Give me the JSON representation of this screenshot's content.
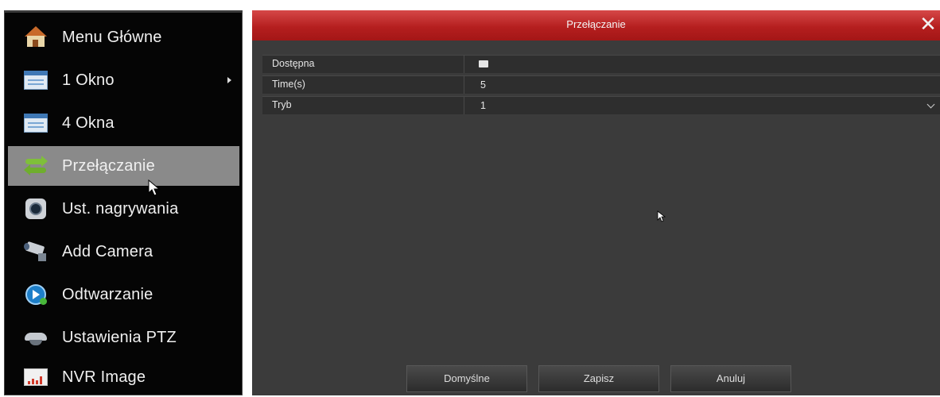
{
  "menu": {
    "items": [
      {
        "label": "Menu Główne",
        "icon": "home-icon"
      },
      {
        "label": "1 Okno",
        "icon": "single-window-icon",
        "has_submenu": true
      },
      {
        "label": "4 Okna",
        "icon": "quad-window-icon"
      },
      {
        "label": "Przełączanie",
        "icon": "switch-arrows-icon",
        "active": true
      },
      {
        "label": "Ust. nagrywania",
        "icon": "record-icon"
      },
      {
        "label": "Add Camera",
        "icon": "camera-icon"
      },
      {
        "label": "Odtwarzanie",
        "icon": "playback-icon"
      },
      {
        "label": "Ustawienia PTZ",
        "icon": "ptz-dome-icon"
      },
      {
        "label": "NVR Image",
        "icon": "nvr-image-icon"
      }
    ]
  },
  "dialog": {
    "title": "Przełączanie",
    "close_glyph": "✕",
    "rows": [
      {
        "label": "Dostępna",
        "type": "checkbox",
        "checked": false
      },
      {
        "label": "Time(s)",
        "value": "5"
      },
      {
        "label": "Tryb",
        "value": "1",
        "type": "select"
      }
    ],
    "buttons": {
      "default": "Domyślne",
      "save": "Zapisz",
      "cancel": "Anuluj"
    }
  },
  "colors": {
    "titlebar": "#b51f1f",
    "dialog_bg": "#3b3b3b",
    "menu_bg": "#050505",
    "menu_active": "#8a8a8a"
  }
}
